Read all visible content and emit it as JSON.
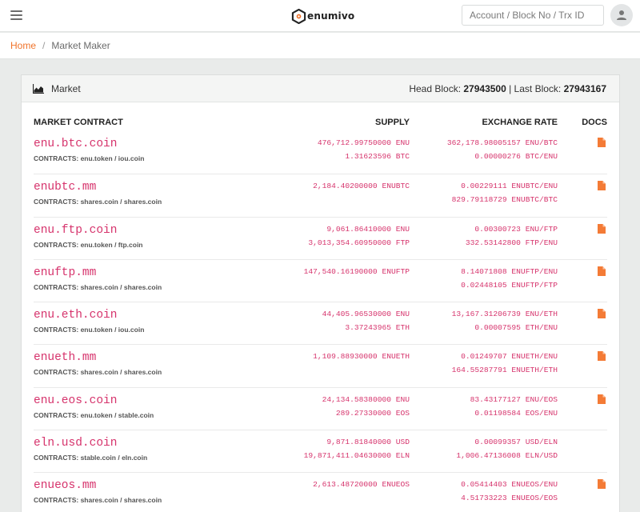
{
  "header": {
    "brand": "enumivo",
    "search_placeholder": "Account / Block No / Trx ID"
  },
  "breadcrumb": {
    "home": "Home",
    "separator": "/",
    "current": "Market Maker"
  },
  "card": {
    "title": "Market",
    "head_block_label": "Head Block:",
    "head_block": "27943500",
    "last_block_label": "| Last Block:",
    "last_block": "27943167"
  },
  "columns": {
    "market": "MARKET CONTRACT",
    "supply": "SUPPLY",
    "rate": "EXCHANGE RATE",
    "docs": "DOCS"
  },
  "contracts_label": "CONTRACTS:",
  "markets": [
    {
      "name": "enu.btc.coin",
      "contracts": "enu.token / iou.coin",
      "supply": [
        "476,712.99750000 ENU",
        "1.31623596 BTC"
      ],
      "rates": [
        "362,178.98005157 ENU/BTC",
        "0.00000276 BTC/ENU"
      ],
      "doc": true
    },
    {
      "name": "enubtc.mm",
      "contracts": "shares.coin / shares.coin",
      "supply": [
        "2,184.40200000 ENUBTC"
      ],
      "rates": [
        "0.00229111 ENUBTC/ENU",
        "829.79118729 ENUBTC/BTC"
      ],
      "doc": true
    },
    {
      "name": "enu.ftp.coin",
      "contracts": "enu.token / ftp.coin",
      "supply": [
        "9,061.86410000 ENU",
        "3,013,354.60950000 FTP"
      ],
      "rates": [
        "0.00300723 ENU/FTP",
        "332.53142800 FTP/ENU"
      ],
      "doc": true
    },
    {
      "name": "enuftp.mm",
      "contracts": "shares.coin / shares.coin",
      "supply": [
        "147,540.16190000 ENUFTP"
      ],
      "rates": [
        "8.14071808 ENUFTP/ENU",
        "0.02448105 ENUFTP/FTP"
      ],
      "doc": true
    },
    {
      "name": "enu.eth.coin",
      "contracts": "enu.token / iou.coin",
      "supply": [
        "44,405.96530000 ENU",
        "3.37243965 ETH"
      ],
      "rates": [
        "13,167.31206739 ENU/ETH",
        "0.00007595 ETH/ENU"
      ],
      "doc": true
    },
    {
      "name": "enueth.mm",
      "contracts": "shares.coin / shares.coin",
      "supply": [
        "1,109.88930000 ENUETH"
      ],
      "rates": [
        "0.01249707 ENUETH/ENU",
        "164.55287791 ENUETH/ETH"
      ],
      "doc": true
    },
    {
      "name": "enu.eos.coin",
      "contracts": "enu.token / stable.coin",
      "supply": [
        "24,134.58380000 ENU",
        "289.27330000 EOS"
      ],
      "rates": [
        "83.43177127 ENU/EOS",
        "0.01198584 EOS/ENU"
      ],
      "doc": true
    },
    {
      "name": "eln.usd.coin",
      "contracts": "stable.coin / eln.coin",
      "supply": [
        "9,871.81840000 USD",
        "19,871,411.04630000 ELN"
      ],
      "rates": [
        "0.00099357 USD/ELN",
        "1,006.47136008 ELN/USD"
      ],
      "doc": false
    },
    {
      "name": "enueos.mm",
      "contracts": "shares.coin / shares.coin",
      "supply": [
        "2,613.48720000 ENUEOS"
      ],
      "rates": [
        "0.05414403 ENUEOS/ENU",
        "4.51733223 ENUEOS/EOS"
      ],
      "doc": true
    }
  ],
  "colors": {
    "accent": "#f0732a",
    "mono_text": "#d6336c",
    "doc_icon": "#f47b36"
  }
}
